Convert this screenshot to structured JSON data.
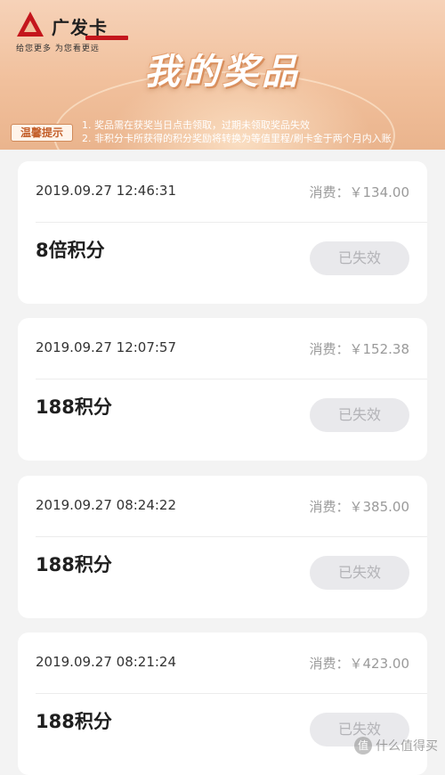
{
  "brand": {
    "name": "广发卡",
    "slogan": "给您更多   为您看更远",
    "logo_color": "#c4161c"
  },
  "header": {
    "title": "我的奖品"
  },
  "tips": {
    "badge": "温馨提示",
    "line1": "1. 奖品需在获奖当日点击领取，过期未领取奖品失效",
    "line2": "2. 非积分卡所获得的积分奖励将转换为等值里程/刷卡金于两个月内入账"
  },
  "prizes": [
    {
      "datetime": "2019.09.27 12:46:31",
      "spend": "消费：￥134.00",
      "prize": "8倍积分",
      "status": "已失效"
    },
    {
      "datetime": "2019.09.27 12:07:57",
      "spend": "消费：￥152.38",
      "prize": "188积分",
      "status": "已失效"
    },
    {
      "datetime": "2019.09.27 08:24:22",
      "spend": "消费：￥385.00",
      "prize": "188积分",
      "status": "已失效"
    },
    {
      "datetime": "2019.09.27 08:21:24",
      "spend": "消费：￥423.00",
      "prize": "188积分",
      "status": "已失效"
    }
  ],
  "watermark": {
    "badge": "值",
    "text": "什么值得买"
  },
  "colors": {
    "header_bg": "#f1c09c",
    "disabled_button": "#e9e9ec",
    "disabled_text": "#b3b3b7"
  }
}
